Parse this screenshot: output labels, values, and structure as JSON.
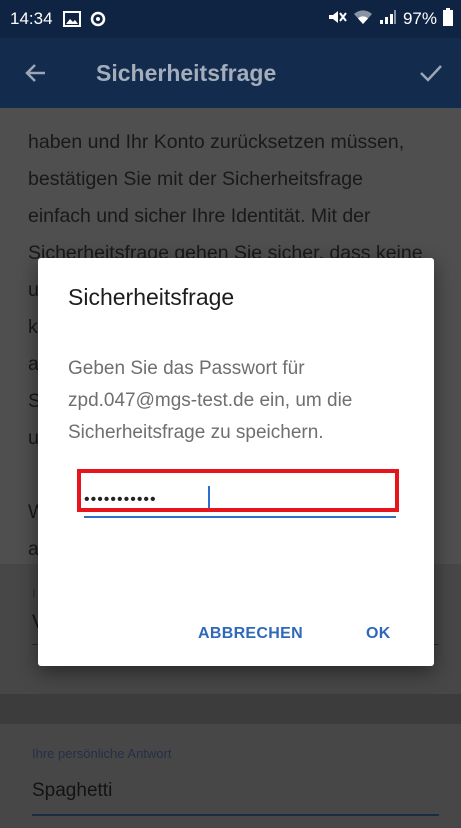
{
  "status_bar": {
    "time": "14:34",
    "battery": "97%"
  },
  "toolbar": {
    "title": "Sicherheitsfrage"
  },
  "background": {
    "paragraph_lines": [
      "haben und Ihr Konto zurücksetzen müssen,",
      "bestätigen Sie mit der Sicherheitsfrage",
      "einfach und sicher Ihre Identität. Mit der",
      "Sicherheitsfrage gehen Sie sicher, dass keine",
      "u",
      "k",
      "a",
      "S",
      "u",
      "",
      "W",
      "a"
    ],
    "question_field": {
      "label": "I",
      "value": "V"
    },
    "answer_field": {
      "label": "Ihre persönliche Antwort",
      "value": "Spaghetti"
    }
  },
  "dialog": {
    "title": "Sicherheitsfrage",
    "message_lines": [
      "Geben Sie das Passwort für",
      "zpd.047@mgs-test.de ein, um die",
      "Sicherheitsfrage zu speichern."
    ],
    "password_value": "•••••••••••",
    "cancel_label": "ABBRECHEN",
    "ok_label": "OK"
  },
  "colors": {
    "toolbar": "#132b4d",
    "status_bar": "#0f2442",
    "accent": "#2f68b9",
    "highlight": "#e8141b"
  }
}
